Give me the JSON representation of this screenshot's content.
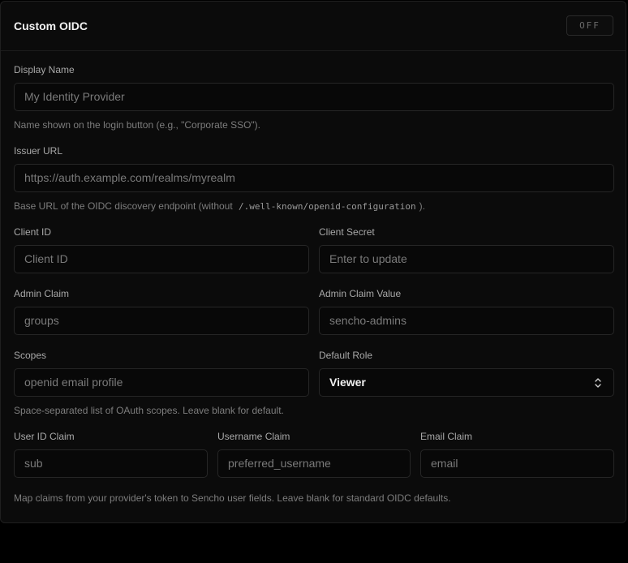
{
  "section": {
    "title": "Custom OIDC",
    "toggle_label": "OFF"
  },
  "display_name": {
    "label": "Display Name",
    "placeholder": "My Identity Provider",
    "help": "Name shown on the login button (e.g., \"Corporate SSO\")."
  },
  "issuer_url": {
    "label": "Issuer URL",
    "placeholder": "https://auth.example.com/realms/myrealm",
    "help_prefix": "Base URL of the OIDC discovery endpoint (without",
    "help_code": "/.well-known/openid-configuration",
    "help_suffix": ")."
  },
  "client_id": {
    "label": "Client ID",
    "placeholder": "Client ID"
  },
  "client_secret": {
    "label": "Client Secret",
    "placeholder": "Enter to update"
  },
  "admin_claim": {
    "label": "Admin Claim",
    "placeholder": "groups"
  },
  "admin_claim_value": {
    "label": "Admin Claim Value",
    "placeholder": "sencho-admins"
  },
  "scopes": {
    "label": "Scopes",
    "placeholder": "openid email profile",
    "help": "Space-separated list of OAuth scopes. Leave blank for default."
  },
  "default_role": {
    "label": "Default Role",
    "value": "Viewer",
    "icon": "chevron-up-down-icon"
  },
  "user_id_claim": {
    "label": "User ID Claim",
    "placeholder": "sub"
  },
  "username_claim": {
    "label": "Username Claim",
    "placeholder": "preferred_username"
  },
  "email_claim": {
    "label": "Email Claim",
    "placeholder": "email"
  },
  "claims_help": "Map claims from your provider's token to Sencho user fields. Leave blank for standard OIDC defaults."
}
